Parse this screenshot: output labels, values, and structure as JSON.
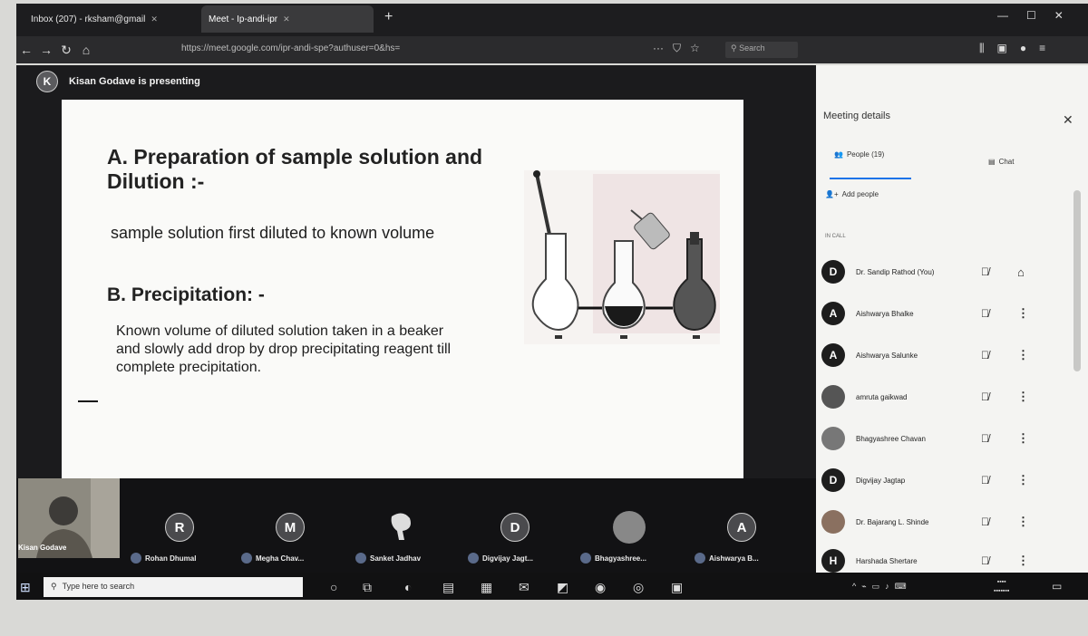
{
  "browser": {
    "tabs": [
      {
        "label": "Inbox (207) - rksham@gmail",
        "active": false
      },
      {
        "label": "Meet - Ip-andi-ipr",
        "active": true
      }
    ],
    "new_tab_icon": "plus-icon",
    "url": "https://meet.google.com/ipr-andi-spe?authuser=0&hs=",
    "search_placeholder": "Search"
  },
  "meeting": {
    "presenter_initial": "K",
    "presenting_label": "Kisan Godave is presenting",
    "self_name": "Kisan Godave"
  },
  "slide": {
    "title_a": "A. Preparation of sample solution and Dilution :-",
    "text_a": "sample solution first diluted to known volume",
    "title_b": "B. Precipitation: -",
    "text_b": "Known volume of diluted solution taken in a beaker and slowly add drop by drop precipitating reagent till complete precipitation."
  },
  "strip": [
    {
      "initial": "R",
      "name": "Rohan Dhumal"
    },
    {
      "initial": "M",
      "name": "Megha Chav..."
    },
    {
      "initial": "",
      "name": "Sanket Jadhav"
    },
    {
      "initial": "D",
      "name": "Digvijay Jagt..."
    },
    {
      "initial": "",
      "name": "Bhagyashree..."
    },
    {
      "initial": "A",
      "name": "Aishwarya B..."
    }
  ],
  "panel": {
    "title": "Meeting details",
    "tab_people": "People (19)",
    "tab_chat": "Chat",
    "add_people": "Add people",
    "in_call": "IN CALL",
    "participants": [
      {
        "initial": "D",
        "name": "Dr. Sandip Rathod (You)"
      },
      {
        "initial": "A",
        "name": "Aishwarya Bhalke"
      },
      {
        "initial": "A",
        "name": "Aishwarya Salunke"
      },
      {
        "initial": "",
        "name": "amruta gaikwad"
      },
      {
        "initial": "",
        "name": "Bhagyashree Chavan"
      },
      {
        "initial": "D",
        "name": "Digvijay Jagtap"
      },
      {
        "initial": "",
        "name": "Dr. Bajarang L. Shinde"
      },
      {
        "initial": "H",
        "name": "Harshada Shertare"
      }
    ]
  },
  "taskbar": {
    "search_placeholder": "Type here to search"
  }
}
